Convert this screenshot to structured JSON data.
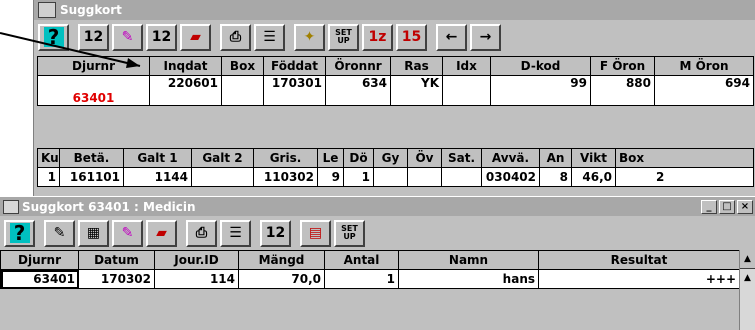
{
  "window1": {
    "title": "Suggkort",
    "toolbar": [
      {
        "name": "help-button",
        "icon": "help-icon",
        "label": "?"
      },
      {
        "name": "calendar-edit-button",
        "icon": "calendar-edit-icon",
        "label": "12"
      },
      {
        "name": "pencil-button",
        "icon": "pencil-icon",
        "label": ""
      },
      {
        "name": "calendar-copy-button",
        "icon": "calendar-copy-icon",
        "label": "12"
      },
      {
        "name": "eraser-button",
        "icon": "eraser-icon",
        "label": ""
      },
      {
        "name": "print-button",
        "icon": "printer-icon",
        "label": ""
      },
      {
        "name": "list-button",
        "icon": "list-icon",
        "label": ""
      },
      {
        "name": "seal-button",
        "icon": "seal-icon",
        "label": ""
      },
      {
        "name": "setup-button",
        "icon": "setup-icon",
        "label": "SET UP"
      },
      {
        "name": "red-numbers-button",
        "icon": "red-numbers-icon",
        "label": "1z"
      },
      {
        "name": "calendar-red-button",
        "icon": "calendar-red-icon",
        "label": "15"
      },
      {
        "name": "prev-button",
        "icon": "arrow-left-icon",
        "label": "←"
      },
      {
        "name": "next-button",
        "icon": "arrow-right-icon",
        "label": "→"
      }
    ],
    "table1": {
      "headers": [
        "Djurnr",
        "Inqdat",
        "Box",
        "Föddat",
        "Öronnr",
        "Ras",
        "Idx",
        "D-kod",
        "F Öron",
        "M Öron"
      ],
      "row": [
        "63401",
        "220601",
        "",
        "170301",
        "634",
        "YK",
        "",
        "99",
        "880",
        "694"
      ]
    },
    "table2": {
      "headers": [
        "Ku",
        "Betä.",
        "Galt 1",
        "Galt 2",
        "Gris.",
        "Le",
        "Dö",
        "Gy",
        "Öv",
        "Sat.",
        "Avvä.",
        "An",
        "Vikt",
        "Box"
      ],
      "row": [
        "1",
        "161101",
        "1144",
        "",
        "110302",
        "9",
        "1",
        "",
        "",
        "",
        "030402",
        "8",
        "46,0",
        "2"
      ]
    }
  },
  "window2": {
    "title": "Suggkort  63401 : Medicin",
    "controls": {
      "minimize": "_",
      "maximize": "□",
      "close": "×"
    },
    "toolbar": [
      {
        "name": "help-button",
        "icon": "help-icon",
        "label": "?"
      },
      {
        "name": "edit-button",
        "icon": "pencil-grid-icon",
        "label": ""
      },
      {
        "name": "calendar-grid-button",
        "icon": "calendar-grid-icon",
        "label": ""
      },
      {
        "name": "pencil-button",
        "icon": "pencil-icon",
        "label": ""
      },
      {
        "name": "eraser-button",
        "icon": "eraser-icon",
        "label": ""
      },
      {
        "name": "print-button",
        "icon": "printer-icon",
        "label": ""
      },
      {
        "name": "list-button",
        "icon": "list-icon",
        "label": ""
      },
      {
        "name": "calendar-copy-button",
        "icon": "calendar-copy-icon",
        "label": "12"
      },
      {
        "name": "data-button",
        "icon": "data-icon",
        "label": ""
      },
      {
        "name": "setup-button",
        "icon": "setup-icon",
        "label": "SET UP"
      }
    ],
    "table": {
      "headers": [
        "Djurnr",
        "Datum",
        "Jour.ID",
        "Mängd",
        "Antal",
        "Namn",
        "Resultat"
      ],
      "row": [
        "63401",
        "170302",
        "114",
        "70,0",
        "1",
        "hans",
        "+++"
      ]
    }
  },
  "colors": {
    "accent_red": "#e00000",
    "title_bar": "#a8a8a8",
    "help_cyan": "#00c0c0"
  }
}
